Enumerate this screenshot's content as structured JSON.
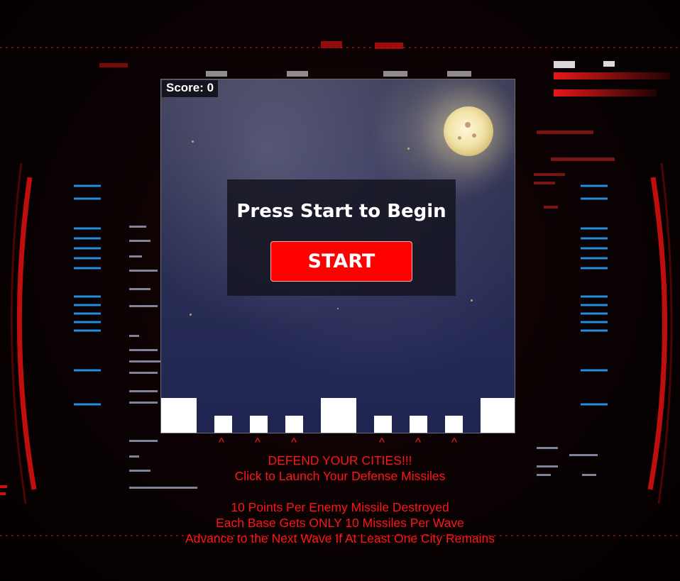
{
  "score": {
    "label": "Score: 0"
  },
  "start_screen": {
    "title": "Press Start to Begin",
    "button_label": "START"
  },
  "launcher_marker": "^",
  "instructions": {
    "line1": "DEFEND YOUR CITIES!!!",
    "line2": "Click to Launch Your Defense Missiles",
    "line3": "10 Points Per Enemy Missile Destroyed",
    "line4": "Each Base Gets ONLY 10 Missiles Per Wave",
    "line5": "Advance to the Next Wave If At Least One City Remains"
  },
  "colors": {
    "accent": "#ff0000",
    "instruction_text": "#ff1616",
    "ground": "#ffffff"
  }
}
